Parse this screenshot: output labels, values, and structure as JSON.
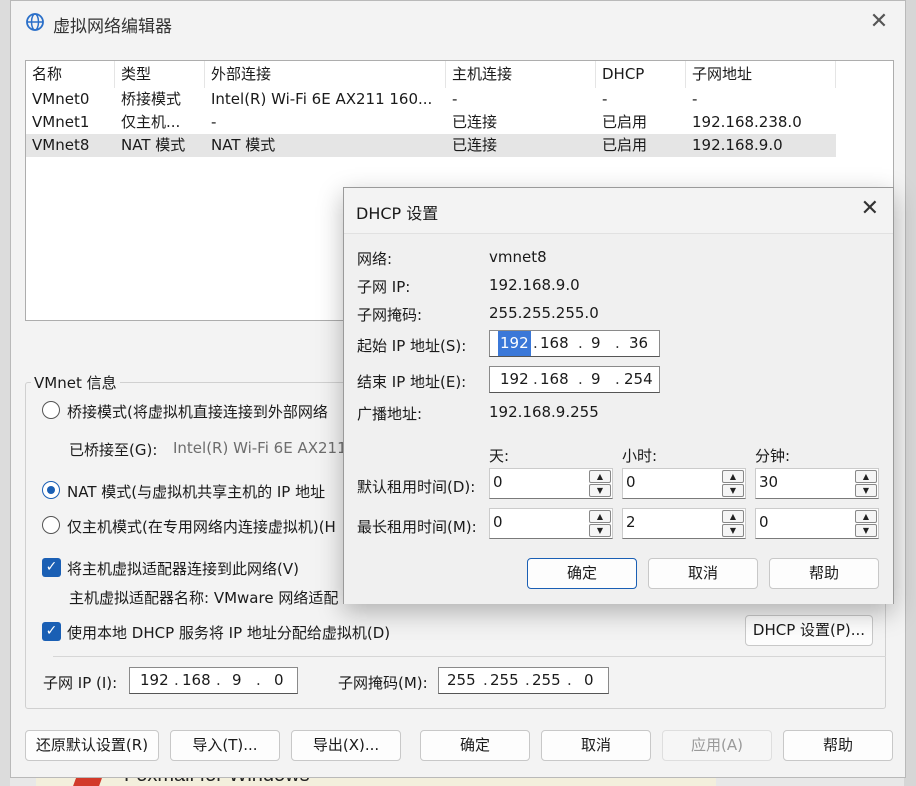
{
  "window": {
    "title": "虚拟网络编辑器",
    "close": "✕"
  },
  "background": {
    "bottom_text": "Foxmail for Windows"
  },
  "table": {
    "headers": [
      "名称",
      "类型",
      "外部连接",
      "主机连接",
      "DHCP",
      "子网地址"
    ],
    "rows": [
      [
        "VMnet0",
        "桥接模式",
        "Intel(R) Wi-Fi 6E AX211 160...",
        "-",
        "-",
        "-"
      ],
      [
        "VMnet1",
        "仅主机...",
        "-",
        "已连接",
        "已启用",
        "192.168.238.0"
      ],
      [
        "VMnet8",
        "NAT 模式",
        "NAT 模式",
        "已连接",
        "已启用",
        "192.168.9.0"
      ]
    ],
    "selected_row": 2
  },
  "vmnet_info": {
    "group_title": "VMnet 信息",
    "bridge_label": "桥接模式(将虚拟机直接连接到外部网络",
    "bridged_to_label": "已桥接至(G):",
    "bridged_to_value": "Intel(R) Wi-Fi 6E AX211",
    "nat_label": "NAT 模式(与虚拟机共享主机的 IP 地址",
    "hostonly_label": "仅主机模式(在专用网络内连接虚拟机)(H",
    "connect_adapter_label": "将主机虚拟适配器连接到此网络(V)",
    "adapter_name_label": "主机虚拟适配器名称: VMware 网络适配",
    "local_dhcp_label": "使用本地 DHCP 服务将 IP 地址分配给虚拟机(D)",
    "dhcp_settings_button": "DHCP 设置(P)...",
    "subnet_ip_label": "子网 IP (I):",
    "subnet_ip": [
      "192",
      "168",
      "9",
      "0"
    ],
    "subnet_mask_label": "子网掩码(M):",
    "subnet_mask": [
      "255",
      "255",
      "255",
      "0"
    ]
  },
  "buttons": {
    "restore": "还原默认设置(R)",
    "import": "导入(T)...",
    "export": "导出(X)...",
    "ok": "确定",
    "cancel": "取消",
    "apply": "应用(A)",
    "help": "帮助"
  },
  "dhcp_dialog": {
    "title": "DHCP 设置",
    "close": "✕",
    "network_label": "网络:",
    "network_value": "vmnet8",
    "subnet_ip_label": "子网 IP:",
    "subnet_ip_value": "192.168.9.0",
    "subnet_mask_label": "子网掩码:",
    "subnet_mask_value": "255.255.255.0",
    "start_ip_label": "起始 IP 地址(S):",
    "start_ip": [
      "192",
      "168",
      "9",
      "36"
    ],
    "end_ip_label": "结束 IP 地址(E):",
    "end_ip": [
      "192",
      "168",
      "9",
      "254"
    ],
    "broadcast_label": "广播地址:",
    "broadcast_value": "192.168.9.255",
    "col_days": "天:",
    "col_hours": "小时:",
    "col_minutes": "分钟:",
    "default_lease_label": "默认租用时间(D):",
    "default_lease": [
      "0",
      "0",
      "30"
    ],
    "max_lease_label": "最长租用时间(M):",
    "max_lease": [
      "0",
      "2",
      "0"
    ],
    "ok": "确定",
    "cancel": "取消",
    "help": "帮助"
  },
  "colors": {
    "accent": "#1a5fb4",
    "selection": "#3b78d8"
  }
}
